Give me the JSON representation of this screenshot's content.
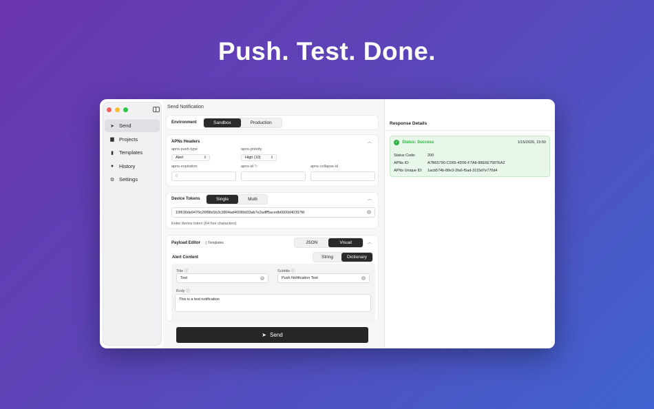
{
  "hero": {
    "headline": "Push. Test. Done."
  },
  "sidebar": {
    "items": [
      {
        "label": "Send",
        "icon": "paper-plane-icon",
        "active": true
      },
      {
        "label": "Projects",
        "icon": "folder-icon",
        "active": false
      },
      {
        "label": "Templates",
        "icon": "document-icon",
        "active": false
      },
      {
        "label": "History",
        "icon": "clock-icon",
        "active": false
      },
      {
        "label": "Settings",
        "icon": "gear-icon",
        "active": false
      }
    ]
  },
  "main": {
    "title": "Send Notification",
    "environment": {
      "label": "Environment",
      "options": [
        "Sandbox",
        "Production"
      ],
      "selected": "Sandbox"
    },
    "apns_headers": {
      "title": "APNs Headers",
      "push_type_label": "apns-push-type",
      "push_type_value": "Alert",
      "priority_label": "apns-priority",
      "priority_value": "High (10)",
      "expiration_label": "apns-expiration",
      "expiration_placeholder": "0",
      "id_label": "apns-id",
      "id_value": "",
      "collapse_label": "apns-collapse-id",
      "collapse_value": ""
    },
    "device_tokens": {
      "title": "Device Tokens",
      "options": [
        "Single",
        "Multi"
      ],
      "selected": "Single",
      "token": "10f630da9470c26f88d1b3c3804ad46089d33ab7e2adff5acedb6600d40397fd",
      "hint": "Enter device token (64 hex characters)"
    },
    "payload_editor": {
      "title": "Payload Editor",
      "templates_link": "Templates",
      "modes": [
        "JSON",
        "Visual"
      ],
      "selected_mode": "Visual",
      "alert_content_label": "Alert Content",
      "content_types": [
        "String",
        "Dictionary"
      ],
      "selected_content_type": "Dictionary",
      "title_label": "Title",
      "title_value": "Test",
      "subtitle_label": "Subtitle",
      "subtitle_value": "Push Notification Test",
      "body_label": "Body",
      "body_value": "This is a test notification"
    },
    "send_label": "Send"
  },
  "response": {
    "title": "Response Details",
    "status": "Status: Success",
    "timestamp": "1/15/2026, 19:50",
    "status_code_label": "Status Code:",
    "status_code": "200",
    "apns_id_label": "APNs ID:",
    "apns_id": "A7B65790-CD65-4D06-F7A8-88E6E7587EA2",
    "apns_unique_label": "APNs Unique ID:",
    "apns_unique_id": "1acb574b-88e3-2fa6-f5ad-3115d7e770d4"
  },
  "colors": {
    "success": "#2fb344",
    "accent_dark": "#262628"
  }
}
